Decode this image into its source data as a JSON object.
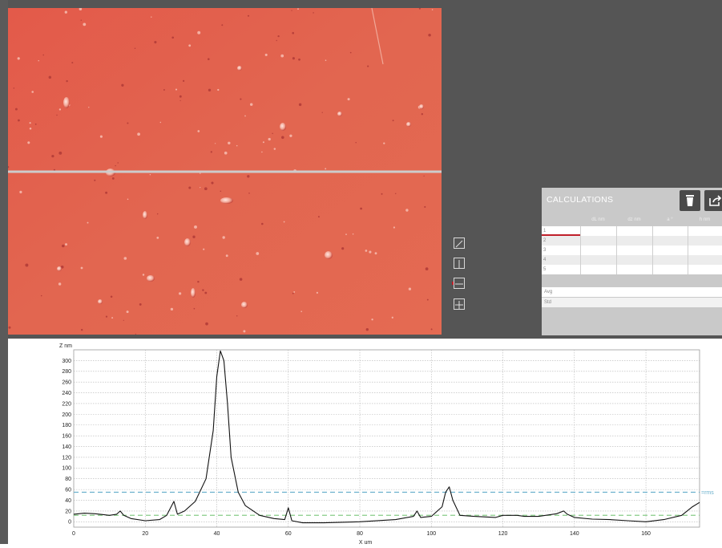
{
  "calculations": {
    "title": "CALCULATIONS",
    "columns": [
      "",
      "dL nm",
      "dz nm",
      "a °",
      "h nm"
    ],
    "rows": [
      "1",
      "2",
      "3",
      "4",
      "5"
    ],
    "avg_label": "Avg",
    "std_label": "Std",
    "delete_icon": "trash-icon",
    "export_icon": "export-icon"
  },
  "tools": {
    "icons": [
      "diagonal-line-icon",
      "vertical-line-icon",
      "horizontal-line-icon",
      "grid-icon"
    ],
    "active_index": 2
  },
  "colors": {
    "image": "#e06050",
    "accent": "#c0202a",
    "rms_line": "#6ab0cc",
    "mean_line": "#88cc88",
    "profile": "#111111"
  },
  "chart_data": {
    "type": "line",
    "ylabel": "Z nm",
    "xlabel": "X um",
    "ylim": [
      -10,
      320
    ],
    "xlim": [
      0,
      175
    ],
    "yticks": [
      0,
      20,
      40,
      60,
      80,
      100,
      120,
      140,
      160,
      180,
      200,
      220,
      240,
      260,
      280,
      300
    ],
    "xticks": [
      0,
      20,
      40,
      60,
      80,
      100,
      120,
      140,
      160
    ],
    "grid": true,
    "rms_value": 55,
    "rms_label": "rms",
    "mean_value": 12,
    "series": [
      {
        "x": [
          0,
          3,
          6,
          10,
          12,
          13,
          14,
          16,
          20,
          24,
          26,
          28,
          29,
          31,
          34,
          37,
          39,
          40,
          41,
          42,
          43,
          44,
          46,
          48,
          52,
          56,
          59,
          60,
          61,
          64,
          70,
          80,
          90,
          95,
          96,
          97,
          100,
          103,
          104,
          105,
          106,
          108,
          112,
          118,
          120,
          124,
          126,
          130,
          135,
          137,
          138,
          140,
          145,
          150,
          155,
          160,
          165,
          170,
          173,
          175
        ],
        "y": [
          14,
          16,
          15,
          12,
          14,
          20,
          12,
          6,
          2,
          4,
          12,
          38,
          14,
          20,
          38,
          80,
          170,
          270,
          318,
          300,
          220,
          120,
          55,
          30,
          12,
          6,
          4,
          26,
          2,
          -2,
          -2,
          0,
          4,
          10,
          20,
          8,
          10,
          28,
          55,
          65,
          40,
          12,
          10,
          8,
          12,
          12,
          10,
          10,
          15,
          20,
          14,
          8,
          5,
          4,
          2,
          0,
          4,
          12,
          28,
          36
        ]
      }
    ]
  }
}
